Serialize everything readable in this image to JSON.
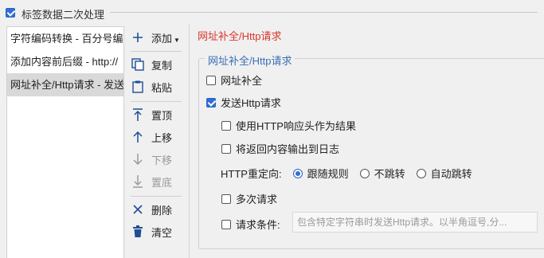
{
  "header": {
    "checked": true,
    "label": "标签数据二次处理"
  },
  "list": {
    "items": [
      {
        "label": "字符编码转换 - 百分号编",
        "selected": false
      },
      {
        "label": "添加内容前后缀 - http://",
        "selected": false
      },
      {
        "label": "网址补全/Http请求 - 发送",
        "selected": true
      }
    ]
  },
  "toolbar": {
    "add": "添加",
    "copy": "复制",
    "paste": "粘贴",
    "top": "置顶",
    "up": "上移",
    "down": "下移",
    "bottom": "置底",
    "delete": "删除",
    "clear": "清空"
  },
  "panel": {
    "title": "网址补全/Http请求",
    "group_title": "网址补全/Http请求",
    "url_complete": {
      "label": "网址补全",
      "checked": false
    },
    "send_http": {
      "label": "发送Http请求",
      "checked": true
    },
    "use_headers": {
      "label": "使用HTTP响应头作为结果",
      "checked": false
    },
    "output_log": {
      "label": "将返回内容输出到日志",
      "checked": false
    },
    "redirect": {
      "label": "HTTP重定向:",
      "options": [
        {
          "label": "跟随规则",
          "selected": true
        },
        {
          "label": "不跳转",
          "selected": false
        },
        {
          "label": "自动跳转",
          "selected": false
        }
      ]
    },
    "multi_request": {
      "label": "多次请求",
      "checked": false
    },
    "condition": {
      "label": "请求条件:",
      "checked": false,
      "placeholder": "包含特定字符串时发送Http请求。以半角逗号,分..."
    }
  },
  "colors": {
    "accent": "#2f6fd6",
    "title_red": "#d9362b",
    "legend_blue": "#3a6db5"
  }
}
